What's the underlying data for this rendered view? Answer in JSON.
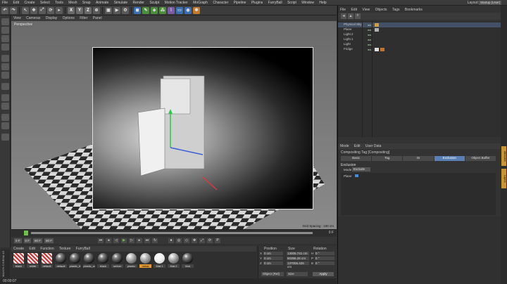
{
  "menubar": {
    "items": [
      "File",
      "Edit",
      "Create",
      "Select",
      "Tools",
      "Mesh",
      "Snap",
      "Animate",
      "Simulate",
      "Render",
      "Sculpt",
      "Motion Tracker",
      "MoGraph",
      "Character",
      "Pipeline",
      "Plugins",
      "FurryBall",
      "Script",
      "Window",
      "Help"
    ],
    "layout_label": "Layout:",
    "layout_value": "Startup (User)"
  },
  "toolbar": {
    "axis_x": "X",
    "axis_y": "Y",
    "axis_z": "Z"
  },
  "viewport": {
    "menu": [
      "View",
      "Cameras",
      "Display",
      "Options",
      "Filter",
      "Panel"
    ],
    "label": "Perspective",
    "grid_spacing": "Grid Spacing : 100 cm"
  },
  "timeline": {
    "ticks": [
      "0",
      "5",
      "10",
      "15",
      "20",
      "25",
      "30",
      "35",
      "40",
      "45",
      "50",
      "55",
      "60",
      "65",
      "70",
      "75",
      "80",
      "85",
      "90"
    ],
    "end_label": "0 F",
    "start_field": "0 F",
    "current_field": "0 F",
    "end_field": "90 F",
    "max_field": "90 F"
  },
  "materials": {
    "menu": [
      "Create",
      "Edit",
      "Function",
      "Texture",
      "FurryBall"
    ],
    "items": [
      {
        "name": "black",
        "style": "stripe"
      },
      {
        "name": "white",
        "style": "stripe"
      },
      {
        "name": "default",
        "style": "stripe"
      },
      {
        "name": "default",
        "style": "dark"
      },
      {
        "name": "plastic_b",
        "style": "dark"
      },
      {
        "name": "plastic_w",
        "style": "dark"
      },
      {
        "name": "black",
        "style": "dark"
      },
      {
        "name": "rubber",
        "style": "dark"
      },
      {
        "name": "plastic",
        "style": "glass"
      },
      {
        "name": "metal",
        "style": "silver"
      },
      {
        "name": "Mat.1",
        "style": "white"
      },
      {
        "name": "Mat.2",
        "style": "glass"
      },
      {
        "name": "Mat",
        "style": "dark"
      }
    ]
  },
  "coords": {
    "position_label": "Position",
    "size_label": "Size",
    "rotation_label": "Rotation",
    "rows": [
      {
        "axis": "X",
        "pos": "0 cm",
        "size": "13005.741 cm",
        "rot_axis": "H",
        "rot": "0 °"
      },
      {
        "axis": "Y",
        "pos": "0 cm",
        "size": "60355.26 cm",
        "rot_axis": "P",
        "rot": "0 °"
      },
      {
        "axis": "Z",
        "pos": "0 cm",
        "size": "137006.426 cm",
        "rot_axis": "B",
        "rot": "0 °"
      }
    ],
    "mode_select": "Object (Rel)",
    "size_select": "Size",
    "apply": "Apply"
  },
  "status": {
    "time": "00:00:07"
  },
  "brand": "MAXON CINEMA 4D",
  "objects": {
    "menu": [
      "File",
      "Edit",
      "View",
      "Objects",
      "Tags",
      "Bookmarks"
    ],
    "rows": [
      {
        "name": "Physical Sky",
        "selected": true
      },
      {
        "name": "Plane",
        "selected": false
      },
      {
        "name": "Light.2",
        "selected": false
      },
      {
        "name": "Light.1",
        "selected": false
      },
      {
        "name": "Light",
        "selected": false
      },
      {
        "name": "Fridge",
        "selected": false
      }
    ]
  },
  "attributes": {
    "menu": [
      "Mode",
      "Edit",
      "User Data"
    ],
    "title": "Compositing Tag [Compositing]",
    "tabs": [
      {
        "label": "Basic",
        "active": false
      },
      {
        "label": "Tag",
        "active": false
      },
      {
        "label": "GI",
        "active": false
      },
      {
        "label": "Exclusion",
        "active": true
      },
      {
        "label": "Object Buffer",
        "active": false
      }
    ],
    "section": "Exclusion",
    "mode_label": "Mode",
    "mode_value": "Exclude",
    "list_item": "Plane"
  },
  "strip_tabs": [
    "Attributes",
    "Layers"
  ]
}
